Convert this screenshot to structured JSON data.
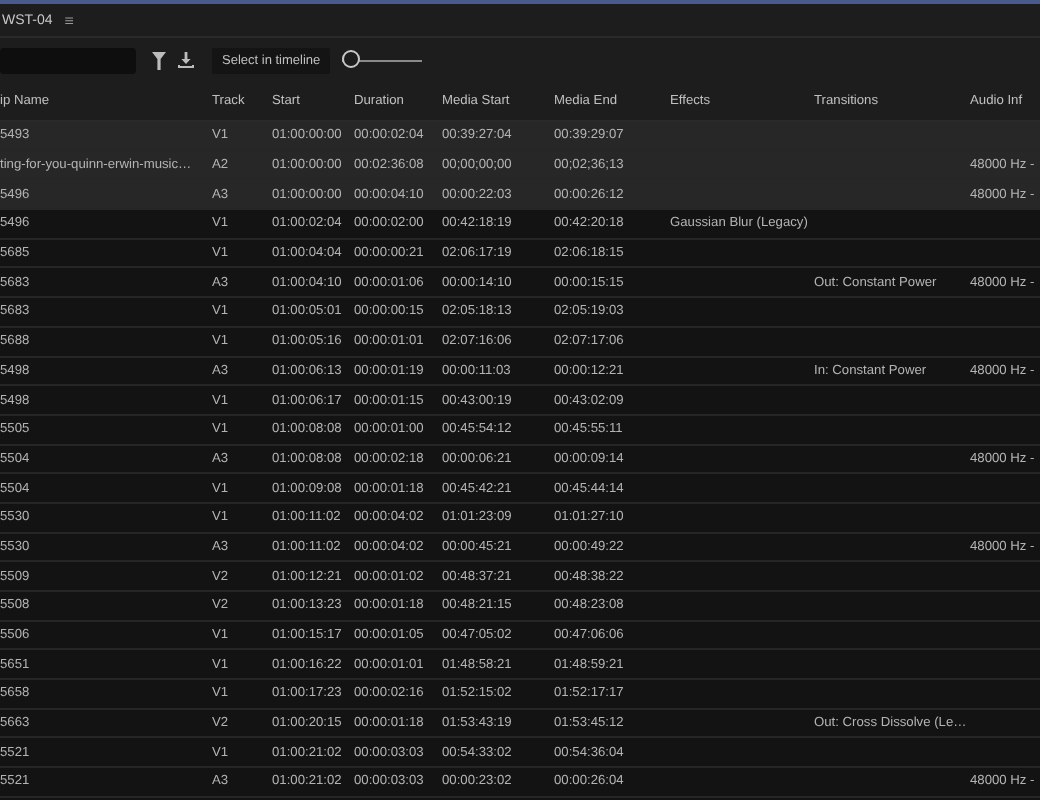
{
  "panel": {
    "title": "WST-04",
    "menu_glyph": "≡"
  },
  "toolbar": {
    "select_button": "Select in timeline",
    "zoom_slider": {
      "level": 0
    }
  },
  "table": {
    "columns": [
      "ip Name",
      "Track",
      "Start",
      "Duration",
      "Media Start",
      "Media End",
      "Effects",
      "Transitions",
      "Audio Inf"
    ],
    "rows": [
      {
        "clip_name": "5493",
        "track": "V1",
        "start": "01:00:00:00",
        "duration": "00:00:02:04",
        "media_start": "00:39:27:04",
        "media_end": "00:39:29:07",
        "selected": true
      },
      {
        "clip_name": "ting-for-you-quinn-erwin-music…",
        "track": "A2",
        "start": "01:00:00:00",
        "duration": "00:02:36:08",
        "media_start": "00;00;00;00",
        "media_end": "00;02;36;13",
        "audio_info": "48000 Hz -",
        "selected": true
      },
      {
        "clip_name": "5496",
        "track": "A3",
        "start": "01:00:00:00",
        "duration": "00:00:04:10",
        "media_start": "00:00:22:03",
        "media_end": "00:00:26:12",
        "audio_info": "48000 Hz -",
        "selected": true
      },
      {
        "clip_name": "5496",
        "track": "V1",
        "start": "01:00:02:04",
        "duration": "00:00:02:00",
        "media_start": "00:42:18:19",
        "media_end": "00:42:20:18",
        "effects": "Gaussian Blur (Legacy)",
        "selected": false
      },
      {
        "clip_name": "5685",
        "track": "V1",
        "start": "01:00:04:04",
        "duration": "00:00:00:21",
        "media_start": "02:06:17:19",
        "media_end": "02:06:18:15",
        "selected": false
      },
      {
        "clip_name": "5683",
        "track": "A3",
        "start": "01:00:04:10",
        "duration": "00:00:01:06",
        "media_start": "00:00:14:10",
        "media_end": "00:00:15:15",
        "transitions": "Out: Constant Power",
        "audio_info": "48000 Hz -",
        "selected": false
      },
      {
        "clip_name": "5683",
        "track": "V1",
        "start": "01:00:05:01",
        "duration": "00:00:00:15",
        "media_start": "02:05:18:13",
        "media_end": "02:05:19:03",
        "selected": false
      },
      {
        "clip_name": "5688",
        "track": "V1",
        "start": "01:00:05:16",
        "duration": "00:00:01:01",
        "media_start": "02:07:16:06",
        "media_end": "02:07:17:06",
        "selected": false
      },
      {
        "clip_name": "5498",
        "track": "A3",
        "start": "01:00:06:13",
        "duration": "00:00:01:19",
        "media_start": "00:00:11:03",
        "media_end": "00:00:12:21",
        "transitions": "In: Constant Power",
        "audio_info": "48000 Hz -",
        "selected": false
      },
      {
        "clip_name": "5498",
        "track": "V1",
        "start": "01:00:06:17",
        "duration": "00:00:01:15",
        "media_start": "00:43:00:19",
        "media_end": "00:43:02:09",
        "selected": false
      },
      {
        "clip_name": "5505",
        "track": "V1",
        "start": "01:00:08:08",
        "duration": "00:00:01:00",
        "media_start": "00:45:54:12",
        "media_end": "00:45:55:11",
        "selected": false
      },
      {
        "clip_name": "5504",
        "track": "A3",
        "start": "01:00:08:08",
        "duration": "00:00:02:18",
        "media_start": "00:00:06:21",
        "media_end": "00:00:09:14",
        "audio_info": "48000 Hz -",
        "selected": false
      },
      {
        "clip_name": "5504",
        "track": "V1",
        "start": "01:00:09:08",
        "duration": "00:00:01:18",
        "media_start": "00:45:42:21",
        "media_end": "00:45:44:14",
        "selected": false
      },
      {
        "clip_name": "5530",
        "track": "V1",
        "start": "01:00:11:02",
        "duration": "00:00:04:02",
        "media_start": "01:01:23:09",
        "media_end": "01:01:27:10",
        "selected": false
      },
      {
        "clip_name": "5530",
        "track": "A3",
        "start": "01:00:11:02",
        "duration": "00:00:04:02",
        "media_start": "00:00:45:21",
        "media_end": "00:00:49:22",
        "audio_info": "48000 Hz -",
        "selected": false
      },
      {
        "clip_name": "5509",
        "track": "V2",
        "start": "01:00:12:21",
        "duration": "00:00:01:02",
        "media_start": "00:48:37:21",
        "media_end": "00:48:38:22",
        "selected": false
      },
      {
        "clip_name": "5508",
        "track": "V2",
        "start": "01:00:13:23",
        "duration": "00:00:01:18",
        "media_start": "00:48:21:15",
        "media_end": "00:48:23:08",
        "selected": false
      },
      {
        "clip_name": "5506",
        "track": "V1",
        "start": "01:00:15:17",
        "duration": "00:00:01:05",
        "media_start": "00:47:05:02",
        "media_end": "00:47:06:06",
        "selected": false
      },
      {
        "clip_name": "5651",
        "track": "V1",
        "start": "01:00:16:22",
        "duration": "00:00:01:01",
        "media_start": "01:48:58:21",
        "media_end": "01:48:59:21",
        "selected": false
      },
      {
        "clip_name": "5658",
        "track": "V1",
        "start": "01:00:17:23",
        "duration": "00:00:02:16",
        "media_start": "01:52:15:02",
        "media_end": "01:52:17:17",
        "selected": false
      },
      {
        "clip_name": "5663",
        "track": "V2",
        "start": "01:00:20:15",
        "duration": "00:00:01:18",
        "media_start": "01:53:43:19",
        "media_end": "01:53:45:12",
        "transitions": "Out: Cross Dissolve (Le…",
        "selected": false
      },
      {
        "clip_name": "5521",
        "track": "V1",
        "start": "01:00:21:02",
        "duration": "00:00:03:03",
        "media_start": "00:54:33:02",
        "media_end": "00:54:36:04",
        "selected": false
      },
      {
        "clip_name": "5521",
        "track": "A3",
        "start": "01:00:21:02",
        "duration": "00:00:03:03",
        "media_start": "00:00:23:02",
        "media_end": "00:00:26:04",
        "audio_info": "48000 Hz -",
        "selected": false
      }
    ]
  }
}
